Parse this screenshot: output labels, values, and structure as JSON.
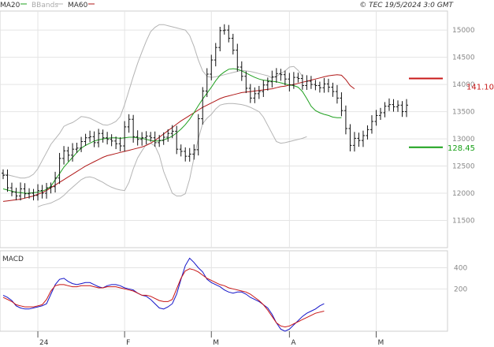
{
  "caption": "© TEC 19/5/2024 3:0 GMT",
  "legend": {
    "ma20": {
      "label": "MA20",
      "color": "#1fa01f"
    },
    "bbands": {
      "label": "BBands",
      "color": "#b4b4b4"
    },
    "ma60": {
      "label": "MA60",
      "color": "#b01818"
    }
  },
  "levels": {
    "resistance": {
      "label": "141.10",
      "value": 14110,
      "color": "#c81818"
    },
    "support": {
      "label": "128.45",
      "value": 12845,
      "color": "#18a018"
    }
  },
  "macd_panel": {
    "label": "MACD"
  },
  "chart_data": [
    {
      "type": "ohlc",
      "y_ticks": [
        11500,
        12000,
        12500,
        13000,
        13500,
        14000,
        14500,
        15000
      ],
      "ylim": [
        11000,
        15350
      ],
      "x_labels": [
        {
          "label": "24",
          "index": 8
        },
        {
          "label": "F",
          "index": 28
        },
        {
          "label": "M",
          "index": 48
        },
        {
          "label": "A",
          "index": 66
        },
        {
          "label": "M",
          "index": 86
        }
      ],
      "series": {
        "close": [
          12330,
          12100,
          12020,
          11950,
          12080,
          11990,
          12000,
          11960,
          12050,
          12000,
          12100,
          12120,
          12280,
          12640,
          12780,
          12700,
          12810,
          12830,
          12950,
          13020,
          13040,
          12930,
          13100,
          13020,
          12990,
          12960,
          12910,
          12870,
          13220,
          13360,
          13040,
          12990,
          13020,
          13050,
          13020,
          12930,
          12970,
          13030,
          13100,
          13140,
          12810,
          12770,
          12680,
          12720,
          12800,
          13370,
          13880,
          14190,
          14450,
          14680,
          14990,
          15000,
          14850,
          14630,
          14320,
          14150,
          13930,
          13750,
          13830,
          13870,
          13990,
          14050,
          14140,
          14200,
          14180,
          14100,
          13990,
          14130,
          14110,
          13980,
          14060,
          14000,
          13980,
          13940,
          14010,
          13950,
          13870,
          13750,
          13520,
          13190,
          12880,
          13010,
          12970,
          13060,
          13170,
          13320,
          13430,
          13480,
          13600,
          13630,
          13590,
          13620,
          13500,
          13620
        ],
        "ma20": [
          12080,
          12060,
          12040,
          12020,
          12010,
          12000,
          12000,
          12010,
          12020,
          12040,
          12070,
          12130,
          12250,
          12360,
          12480,
          12570,
          12660,
          12750,
          12830,
          12880,
          12920,
          12960,
          12980,
          13000,
          13010,
          13020,
          13020,
          13010,
          13020,
          13030,
          13030,
          13020,
          13010,
          12990,
          12970,
          12960,
          12960,
          12980,
          13010,
          13050,
          13110,
          13180,
          13260,
          13360,
          13480,
          13610,
          13730,
          13840,
          13950,
          14070,
          14170,
          14230,
          14280,
          14290,
          14280,
          14250,
          14210,
          14170,
          14130,
          14100,
          14080,
          14070,
          14060,
          14050,
          14030,
          14010,
          13990,
          13980,
          13950,
          13870,
          13740,
          13600,
          13520,
          13480,
          13450,
          13430,
          13400,
          13390,
          13390
        ],
        "ma20_start": 0,
        "ma60": [
          11850,
          11860,
          11870,
          11880,
          11890,
          11910,
          11930,
          11950,
          11980,
          12010,
          12050,
          12100,
          12150,
          12200,
          12250,
          12300,
          12350,
          12400,
          12450,
          12500,
          12540,
          12580,
          12620,
          12660,
          12690,
          12710,
          12730,
          12750,
          12770,
          12790,
          12810,
          12830,
          12850,
          12880,
          12920,
          12970,
          13030,
          13090,
          13150,
          13210,
          13270,
          13330,
          13380,
          13430,
          13480,
          13530,
          13580,
          13620,
          13660,
          13700,
          13740,
          13770,
          13790,
          13810,
          13830,
          13850,
          13860,
          13870,
          13880,
          13890,
          13900,
          13910,
          13920,
          13940,
          13960,
          13970,
          13990,
          14000,
          14020,
          14040,
          14060,
          14080,
          14100,
          14120,
          14140,
          14160,
          14170,
          14180,
          14170,
          14090,
          13980,
          13920
        ],
        "ma60_start": 0,
        "bb_upper": [
          12350,
          12340,
          12320,
          12300,
          12280,
          12280,
          12300,
          12350,
          12450,
          12600,
          12750,
          12900,
          13000,
          13100,
          13230,
          13270,
          13300,
          13350,
          13410,
          13400,
          13380,
          13340,
          13300,
          13260,
          13250,
          13280,
          13320,
          13410,
          13630,
          13890,
          14150,
          14390,
          14600,
          14800,
          14970,
          15050,
          15100,
          15100,
          15080,
          15060,
          15040,
          15020,
          15000,
          14900,
          14700,
          14450,
          14250,
          14150,
          14130,
          14140,
          14160,
          14180,
          14200,
          14220,
          14240,
          14260,
          14250,
          14240,
          14220,
          14200,
          14180,
          14160,
          14120,
          14150,
          14200,
          14250,
          14320,
          14330,
          14260,
          14150
        ],
        "bb_upper_start": 0,
        "bb_lower": [
          11750,
          11780,
          11800,
          11820,
          11860,
          11900,
          11960,
          12040,
          12110,
          12180,
          12250,
          12290,
          12300,
          12280,
          12240,
          12200,
          12150,
          12110,
          12080,
          12060,
          12050,
          12200,
          12450,
          12650,
          12780,
          12900,
          12920,
          12870,
          12700,
          12400,
          12200,
          12000,
          11950,
          11950,
          11990,
          12260,
          12650,
          13000,
          13280,
          13380,
          13450,
          13550,
          13620,
          13640,
          13650,
          13650,
          13640,
          13630,
          13610,
          13580,
          13540,
          13500,
          13400,
          13250,
          13100,
          12950,
          12920,
          12930,
          12950,
          12970,
          12990,
          13010,
          13040
        ],
        "bb_lower_start": 8
      }
    },
    {
      "type": "line",
      "title": "MACD",
      "y_ticks": [
        200,
        400
      ],
      "ylim": [
        -200,
        560
      ],
      "series": [
        {
          "name": "MACD",
          "color": "#1414c8",
          "values": [
            140,
            120,
            90,
            40,
            20,
            10,
            10,
            20,
            30,
            40,
            60,
            150,
            240,
            290,
            300,
            270,
            250,
            240,
            250,
            260,
            260,
            240,
            220,
            210,
            230,
            240,
            240,
            230,
            210,
            200,
            190,
            160,
            140,
            130,
            100,
            60,
            20,
            10,
            30,
            60,
            150,
            290,
            420,
            490,
            450,
            400,
            360,
            290,
            260,
            240,
            220,
            190,
            170,
            160,
            170,
            170,
            150,
            120,
            100,
            80,
            50,
            20,
            -40,
            -120,
            -180,
            -200,
            -180,
            -140,
            -100,
            -60,
            -30,
            -10,
            10,
            40,
            60
          ]
        },
        {
          "name": "Signal",
          "color": "#c81414",
          "values": [
            120,
            100,
            80,
            50,
            40,
            30,
            30,
            30,
            40,
            50,
            100,
            180,
            230,
            240,
            240,
            230,
            220,
            220,
            230,
            230,
            230,
            220,
            210,
            210,
            220,
            220,
            220,
            210,
            200,
            190,
            180,
            160,
            140,
            140,
            130,
            110,
            90,
            80,
            80,
            100,
            200,
            300,
            370,
            390,
            380,
            360,
            330,
            300,
            280,
            260,
            240,
            230,
            210,
            200,
            190,
            180,
            170,
            150,
            120,
            90,
            50,
            0,
            -60,
            -120,
            -150,
            -160,
            -150,
            -130,
            -110,
            -90,
            -70,
            -50,
            -30,
            -20,
            -10
          ]
        }
      ]
    }
  ]
}
